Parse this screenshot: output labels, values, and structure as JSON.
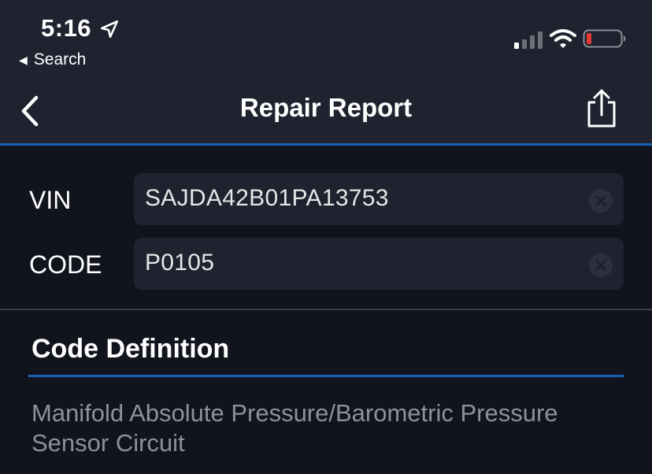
{
  "status_bar": {
    "time": "5:16",
    "back_app_label": "Search",
    "icons": [
      "location-arrow-icon",
      "cellular-signal-icon",
      "wifi-icon",
      "battery-low-icon"
    ]
  },
  "nav": {
    "title": "Repair Report",
    "back_icon": "chevron-left-icon",
    "share_icon": "share-icon"
  },
  "form": {
    "vin_label": "VIN",
    "vin_value": "SAJDA42B01PA13753",
    "code_label": "CODE",
    "code_value": "P0105",
    "clear_icon": "clear-circle-icon"
  },
  "definition_section": {
    "title": "Code Definition",
    "text": "Manifold Absolute Pressure/Barometric Pressure Sensor Circuit"
  },
  "colors": {
    "background": "#11141d",
    "header": "#1f2330",
    "accent": "#1763b8",
    "battery_low": "#e53935"
  }
}
